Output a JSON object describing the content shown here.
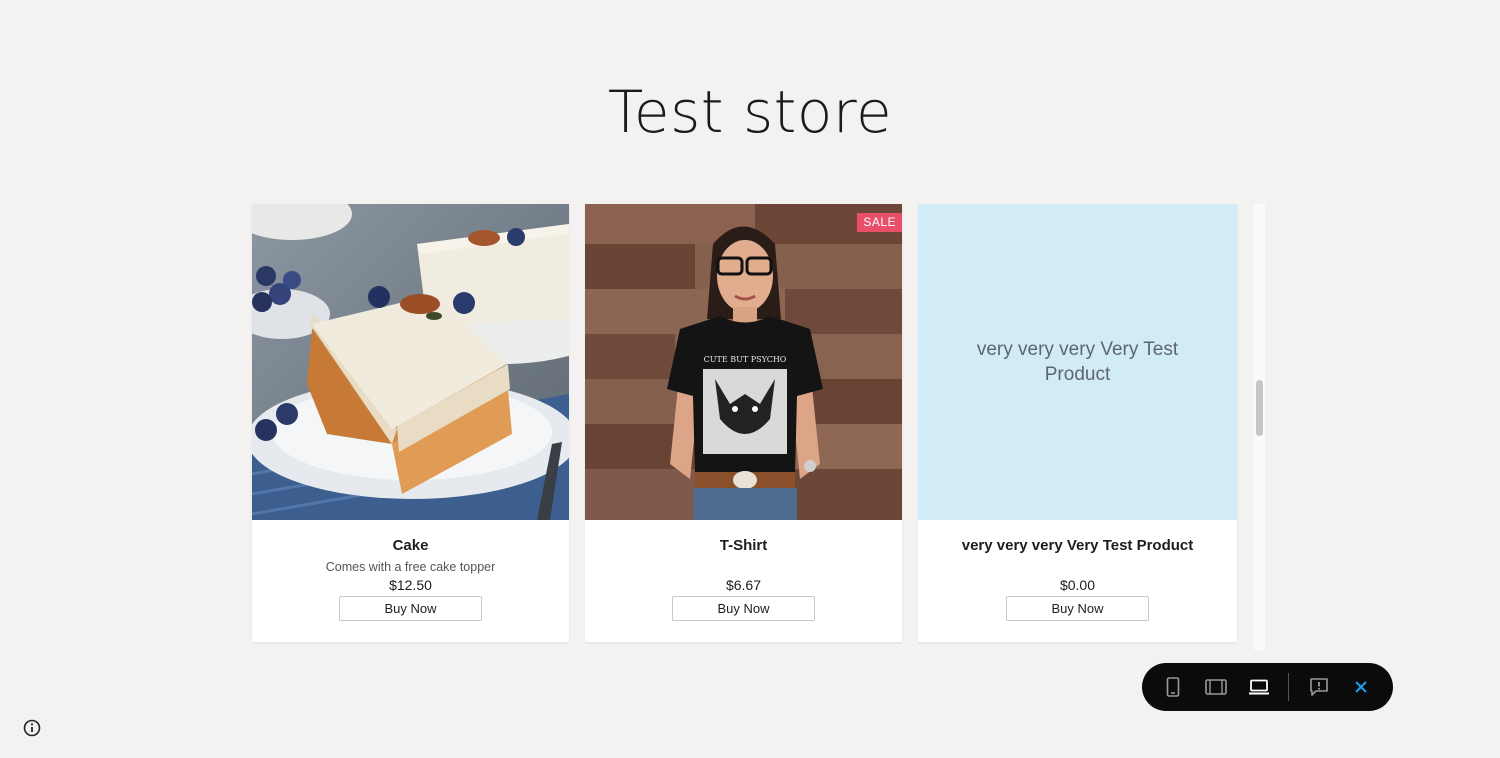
{
  "store": {
    "title": "Test store"
  },
  "products": [
    {
      "name": "Cake",
      "description": "Comes with a free cake topper",
      "price": "$12.50",
      "button_label": "Buy Now"
    },
    {
      "name": "T-Shirt",
      "description": "",
      "price": "$6.67",
      "button_label": "Buy Now",
      "badge": "SALE",
      "shirt_print": "CUTE BUT PSYCHO"
    },
    {
      "name": "very very very Very Test Product",
      "description": "",
      "price": "$0.00",
      "button_label": "Buy Now",
      "image_placeholder_text": "very very very Very Test Product"
    }
  ],
  "toolbar": {
    "icons": [
      "mobile-view-icon",
      "tablet-view-icon",
      "desktop-view-icon",
      "feedback-icon",
      "close-icon"
    ],
    "active_view": "desktop",
    "accent_color": "#1a9bf0"
  },
  "colors": {
    "background": "#f3f2f1",
    "sale_badge": "#e8506a",
    "placeholder": "#d1ebf7"
  }
}
